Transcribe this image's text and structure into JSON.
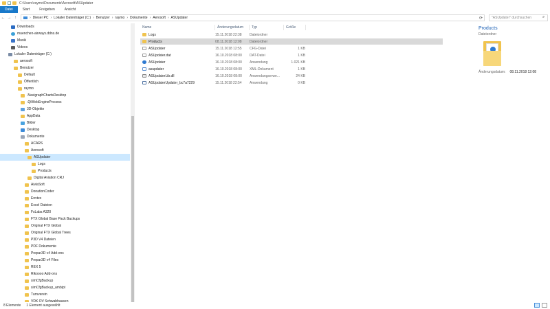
{
  "window": {
    "title_path": "C:\\Users\\raymo\\Documents\\Aerosoft\\ASUpdater"
  },
  "ribbon": {
    "tabs": [
      "Datei",
      "Start",
      "Freigeben",
      "Ansicht"
    ]
  },
  "address": {
    "crumbs": [
      "Dieser PC",
      "Lokaler Datenträger (C:)",
      "Benutzer",
      "raymo",
      "Dokumente",
      "Aerosoft",
      "ASUpdater"
    ],
    "refresh_icon": "refresh-icon"
  },
  "search": {
    "placeholder": "\"ASUpdater\" durchsuchen"
  },
  "nav": {
    "items": [
      {
        "label": "Downloads",
        "icon": "download"
      },
      {
        "label": "muenchen-airways.ddns.de",
        "icon": "globe"
      },
      {
        "label": "Musik",
        "icon": "music"
      },
      {
        "label": "Videos",
        "icon": "video"
      },
      {
        "label": "Lokaler Datenträger (C:)",
        "icon": "drive"
      },
      {
        "label": "aerosoft",
        "icon": "folder"
      },
      {
        "label": "Benutzer",
        "icon": "folder"
      },
      {
        "label": "Default",
        "icon": "folder"
      },
      {
        "label": "Öffentlich",
        "icon": "folder"
      },
      {
        "label": "raymo",
        "icon": "folder"
      },
      {
        "label": ".NavigraphChartsDesktop",
        "icon": "folder"
      },
      {
        "label": ".QtWebEngineProcess",
        "icon": "folder"
      },
      {
        "label": "3D-Objekte",
        "icon": "objects"
      },
      {
        "label": "AppData",
        "icon": "folder"
      },
      {
        "label": "Bilder",
        "icon": "pictures"
      },
      {
        "label": "Desktop",
        "icon": "desktop"
      },
      {
        "label": "Dokumente",
        "icon": "docs"
      },
      {
        "label": "ACARS",
        "icon": "folder"
      },
      {
        "label": "Aerosoft",
        "icon": "folder"
      },
      {
        "label": "ASUpdater",
        "icon": "folder"
      },
      {
        "label": "Logs",
        "icon": "folder"
      },
      {
        "label": "Products",
        "icon": "folder"
      },
      {
        "label": "Digital Aviation CRJ",
        "icon": "folder"
      },
      {
        "label": "AivlaSoft",
        "icon": "folder"
      },
      {
        "label": "DonationCoder",
        "icon": "folder"
      },
      {
        "label": "Envtex",
        "icon": "folder"
      },
      {
        "label": "Excel Dateien",
        "icon": "folder"
      },
      {
        "label": "FsLabs A320",
        "icon": "folder"
      },
      {
        "label": "FTX Global Base Pack Backups",
        "icon": "folder"
      },
      {
        "label": "Original FTX Global",
        "icon": "folder"
      },
      {
        "label": "Original FTX Global Trees",
        "icon": "folder"
      },
      {
        "label": "P3D V4 Dateien",
        "icon": "folder"
      },
      {
        "label": "PDF Dokumente",
        "icon": "folder"
      },
      {
        "label": "Prepar3D v4 Add-ons",
        "icon": "folder"
      },
      {
        "label": "Prepar3D v4 Files",
        "icon": "folder"
      },
      {
        "label": "REX 5",
        "icon": "folder"
      },
      {
        "label": "Rikoooo Add-ons",
        "icon": "folder"
      },
      {
        "label": "simCfgBackup",
        "icon": "folder"
      },
      {
        "label": "simCfgBackup_ambipt",
        "icon": "folder"
      },
      {
        "label": "Turnverein",
        "icon": "folder"
      },
      {
        "label": "VDK OV Schwabhausen",
        "icon": "folder"
      }
    ]
  },
  "files": {
    "columns": [
      "Name",
      "Änderungsdatum",
      "Typ",
      "Größe"
    ],
    "rows": [
      {
        "name": "Logs",
        "date": "15.11.2018 22:38",
        "type": "Dateiordner",
        "size": "",
        "icon": "folder"
      },
      {
        "name": "Products",
        "date": "08.11.2018 12:08",
        "type": "Dateiordner",
        "size": "",
        "icon": "folder"
      },
      {
        "name": "ASUpdater",
        "date": "15.11.2018 12:55",
        "type": "CFG-Datei",
        "size": "1 KB",
        "icon": "cfg"
      },
      {
        "name": "ASUpdater.dat",
        "date": "16.10.2018 08:00",
        "type": "DAT-Datei",
        "size": "1 KB",
        "icon": "cfg"
      },
      {
        "name": "ASUpdater",
        "date": "16.10.2018 08:00",
        "type": "Anwendung",
        "size": "1.021 KB",
        "icon": "app"
      },
      {
        "name": "asupdater",
        "date": "16.10.2018 08:00",
        "type": "XML-Dokument",
        "size": "1 KB",
        "icon": "xml"
      },
      {
        "name": "ASUpdaterLib.dll",
        "date": "16.10.2018 08:00",
        "type": "Anwendungserwe...",
        "size": "24 KB",
        "icon": "dll"
      },
      {
        "name": "ASUpdaterUpdater_bc7a7229",
        "date": "15.11.2018 22:54",
        "type": "Anwendung",
        "size": "0 KB",
        "icon": "exe"
      }
    ]
  },
  "preview": {
    "title": "Products",
    "type": "Dateiordner",
    "meta_label": "Änderungsdatum:",
    "meta_value": "08.11.2018 12:08"
  },
  "status": {
    "count": "8 Elemente",
    "selection": "1 Element ausgewählt"
  },
  "colors": {
    "accent": "#1979ca",
    "selection": "#cce8ff",
    "folder": "#f0c34e"
  }
}
